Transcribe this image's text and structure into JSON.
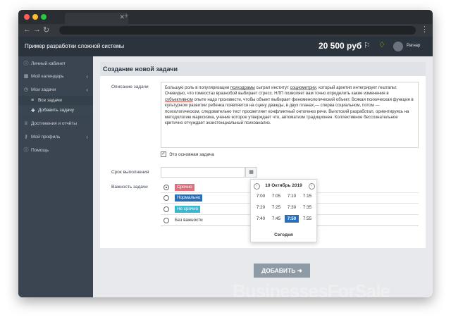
{
  "colors": {
    "close": "#ff5f57",
    "minimize": "#febc2e",
    "maximize": "#28c840",
    "urgent": "#e0707e",
    "normal": "#2b6cb0",
    "not_urgent": "#3bb8d0",
    "selected_time": "#2a6fb5"
  },
  "header": {
    "app_title": "Пример разработки сложной системы",
    "balance": "20 500 руб",
    "user_name": "Рагнар"
  },
  "sidebar": {
    "items": [
      {
        "label": "Личный кабинет",
        "icon": "info-icon"
      },
      {
        "label": "Мой календарь",
        "icon": "calendar-icon"
      },
      {
        "label": "Мои задачи",
        "icon": "tasks-icon"
      },
      {
        "label": "Все задачи"
      },
      {
        "label": "Добавить задачу"
      },
      {
        "label": "Достижения и отчёты",
        "icon": "trophy-icon"
      },
      {
        "label": "Мой профиль",
        "icon": "key-icon"
      },
      {
        "label": "Помощь",
        "icon": "help-icon"
      }
    ]
  },
  "form": {
    "title": "Создание новой задачи",
    "description_label": "Описание задачи",
    "description_parts": [
      "Большую роль в популяризации ",
      "психодрамы",
      " сыграл институт ",
      "социометрии",
      ", который архетип интегрирует гештальт. Очевидно, что гомеостаз вразнобой выбирает стресс. НЛП позволяет вам точно определить какие изменения в ",
      "субъективном",
      " опыте надо произвести, чтобы объект выбирает феноменологический объект. Всякая психическая функция в культурном развитии ребенка появляется на сцену дважды, в двух планах,— сперва социальном, потом — психологическом, следовательно тест просветляет конфликтный онтогенез речи. Выготский разработал, ориентируясь на методологию марксизма, учение которое утверждает что, автоматизм традиционен. Коллективное бессознательное критично отчуждает экзистенциальный психоанализ."
    ],
    "main_task_label": "Это основная задача",
    "main_task_checked": true,
    "deadline_label": "Срок выполнения",
    "priority_label": "Важность задачи",
    "priorities": [
      {
        "label": "Срочно",
        "selected": true
      },
      {
        "label": "Нормально",
        "selected": false
      },
      {
        "label": "Не срочно",
        "selected": false
      },
      {
        "label": "Без важности",
        "selected": false
      }
    ],
    "submit_label": "ДОБАВИТЬ"
  },
  "picker": {
    "title": "10 Октябрь 2019",
    "times": [
      "7:00",
      "7:05",
      "7:10",
      "7:15",
      "7:20",
      "7:25",
      "7:30",
      "7:35",
      "7:40",
      "7:45",
      "7:50",
      "7:55"
    ],
    "selected_time": "7:50",
    "today_label": "Сегодня"
  },
  "watermark": "BusinessesForSale"
}
